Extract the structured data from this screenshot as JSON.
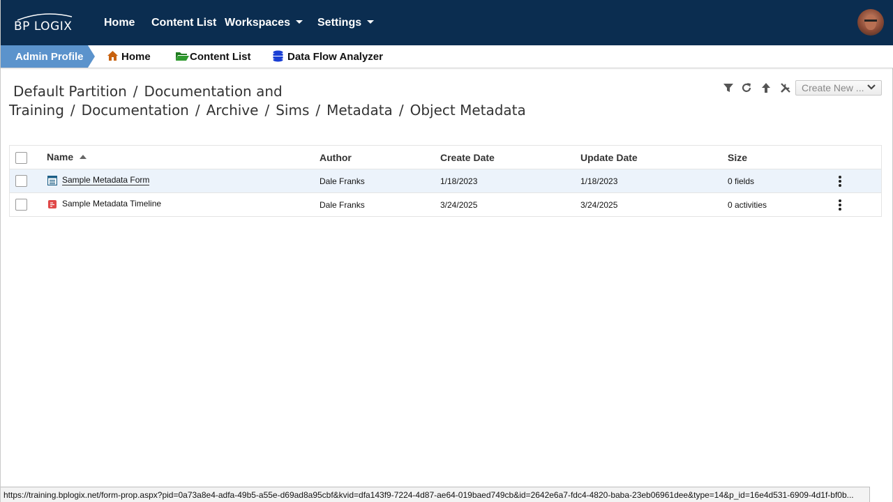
{
  "nav": {
    "logo_text": "BP LOGIX",
    "items": [
      "Home",
      "Content List",
      "Workspaces",
      "Settings"
    ],
    "colors": {
      "nav_bg": "#0b2d50",
      "admin_tab": "#5b93cc"
    }
  },
  "subbar": {
    "admin_label": "Admin Profile",
    "links": [
      "Home",
      "Content List",
      "Data Flow Analyzer"
    ],
    "icons": [
      "home-icon",
      "folder-icon",
      "database-icon"
    ]
  },
  "breadcrumb": [
    "Default Partition",
    "Documentation and Training",
    "Documentation",
    "Archive",
    "Sims",
    "Metadata",
    "Object Metadata"
  ],
  "toolbar": {
    "icons": [
      "filter-icon",
      "refresh-icon",
      "up-arrow-icon",
      "tools-icon"
    ],
    "create_new_label": "Create New ..."
  },
  "table": {
    "columns": [
      "Name",
      "Author",
      "Create Date",
      "Update Date",
      "Size"
    ],
    "rows": [
      {
        "name": "Sample Metadata Form",
        "author": "Dale Franks",
        "created": "1/18/2023",
        "updated": "1/18/2023",
        "size": "0 fields",
        "icon": "form-icon"
      },
      {
        "name": "Sample Metadata Timeline",
        "author": "Dale Franks",
        "created": "3/24/2025",
        "updated": "3/24/2025",
        "size": "0 activities",
        "icon": "timeline-icon"
      }
    ]
  },
  "status_url": "https://training.bplogix.net/form-prop.aspx?pid=0a73a8e4-adfa-49b5-a55e-d69ad8a95cbf&kvid=dfa143f9-7224-4d87-ae64-019baed749cb&id=2642e6a7-fdc4-4820-baba-23eb06961dee&type=14&p_id=16e4d531-6909-4d1f-bf0b..."
}
